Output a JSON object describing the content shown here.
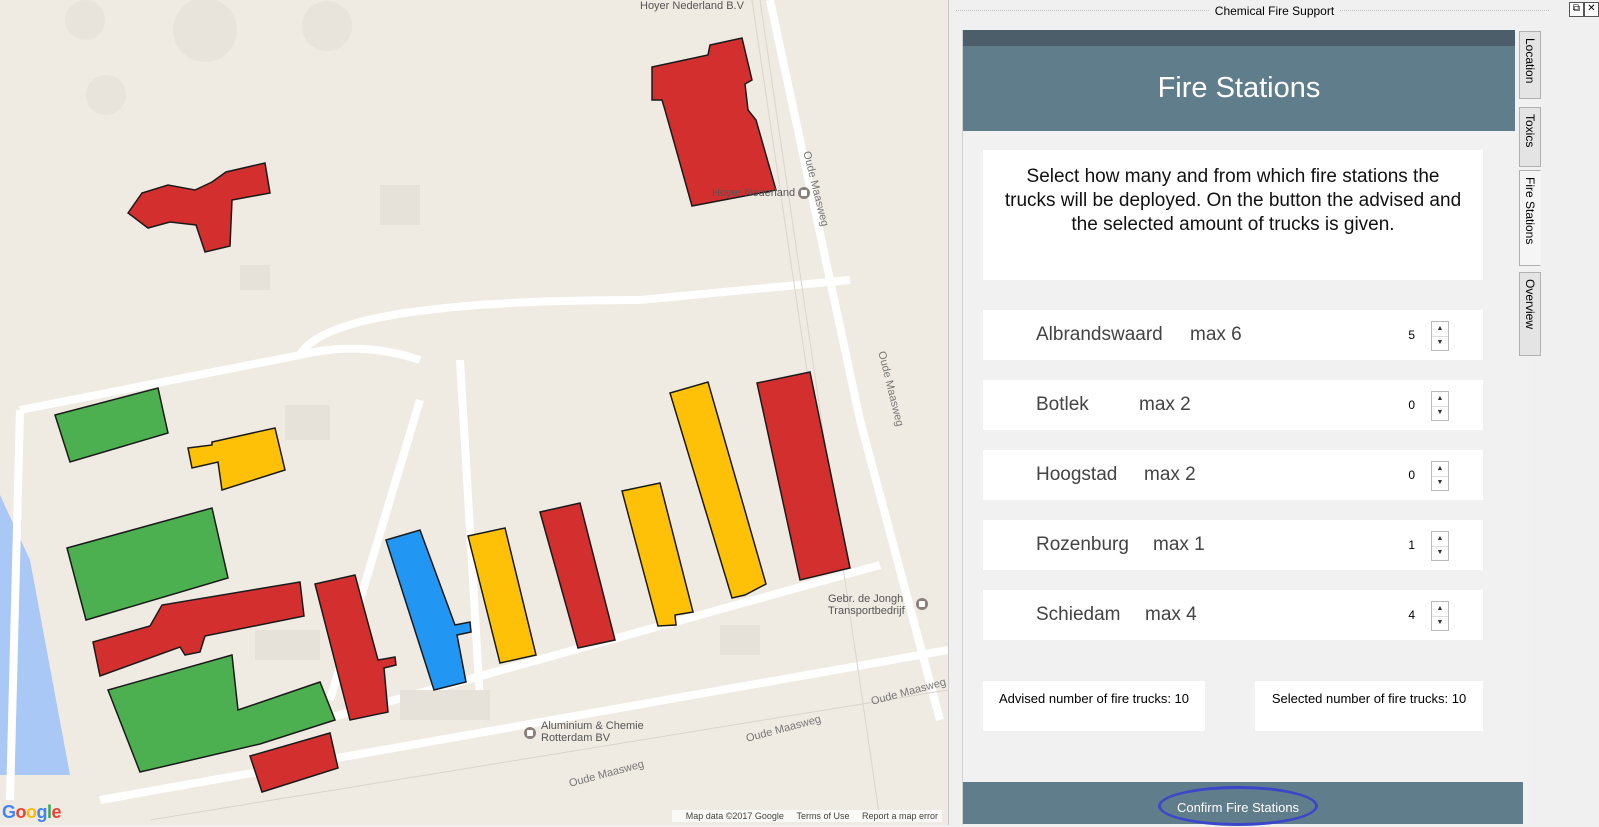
{
  "map": {
    "labels": {
      "hoyer_top": "Hoyer Nederland B.V",
      "hoyer": "Hoyer Nederland",
      "gebr": "Gebr. de Jongh",
      "gebr2": "Transportbedrijf",
      "alu": "Aluminium & Chemie",
      "alu2": "Rotterdam BV",
      "road1": "Oude Maasweg",
      "road2": "Oude Maasweg",
      "road3": "Oude Maasweg",
      "road4": "Oude Maasweg",
      "road5": "Oude Maasweg"
    },
    "footer": {
      "data": "Map data ©2017 Google",
      "terms": "Terms of Use",
      "report": "Report a map error"
    },
    "logo": "Google",
    "building_colors": {
      "red": "#d32f2f",
      "green": "#4caf50",
      "yellow": "#ffc107",
      "blue": "#2196f3"
    }
  },
  "window": {
    "title": "Chemical Fire Support",
    "restore_icon": "restore-icon",
    "close_icon": "close-icon"
  },
  "panel": {
    "header": "Fire Stations",
    "description": "Select how many and from which fire stations the trucks will be deployed. On the button the advised and the selected amount of trucks is given.",
    "stations": [
      {
        "name": "Albrandswaard",
        "max": "max 6",
        "value": "5"
      },
      {
        "name": "Botlek",
        "max": "max 2",
        "value": "0"
      },
      {
        "name": "Hoogstad",
        "max": "max 2",
        "value": "0"
      },
      {
        "name": "Rozenburg",
        "max": "max 1",
        "value": "1"
      },
      {
        "name": "Schiedam",
        "max": "max 4",
        "value": "4"
      }
    ],
    "advised": "Advised number of fire trucks: 10",
    "selected": "Selected number of fire trucks: 10",
    "confirm": "Confirm Fire Stations"
  },
  "tabs": [
    {
      "label": "Location",
      "active": false
    },
    {
      "label": "Toxics",
      "active": false
    },
    {
      "label": "Fire Stations",
      "active": true
    },
    {
      "label": "Overview",
      "active": false
    }
  ]
}
